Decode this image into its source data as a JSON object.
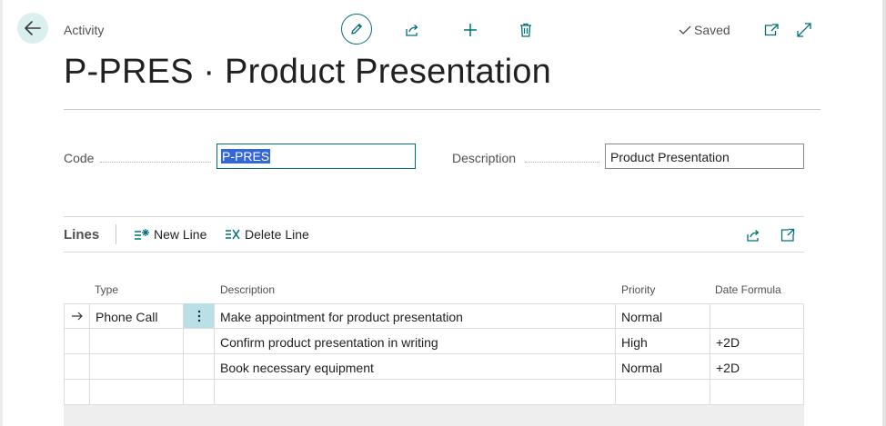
{
  "header": {
    "breadcrumb": "Activity",
    "saved_label": "Saved",
    "title": "P-PRES · Product Presentation"
  },
  "fields": {
    "code_label": "Code",
    "code_value": "P-PRES",
    "description_label": "Description",
    "description_value": "Product Presentation"
  },
  "lines": {
    "title": "Lines",
    "new_line_label": "New Line",
    "delete_line_label": "Delete Line",
    "columns": {
      "type": "Type",
      "description": "Description",
      "priority": "Priority",
      "date_formula": "Date Formula"
    },
    "rows": [
      {
        "type": "Phone Call",
        "description": "Make appointment for product presentation",
        "priority": "Normal",
        "date_formula": ""
      },
      {
        "type": "",
        "description": "Confirm product presentation in writing",
        "priority": "High",
        "date_formula": "+2D"
      },
      {
        "type": "",
        "description": "Book necessary equipment",
        "priority": "Normal",
        "date_formula": "+2D"
      },
      {
        "type": "",
        "description": "",
        "priority": "",
        "date_formula": ""
      }
    ]
  },
  "colors": {
    "accent": "#00707a",
    "selection": "#3367d6",
    "active_cell": "#b8e0e6"
  }
}
